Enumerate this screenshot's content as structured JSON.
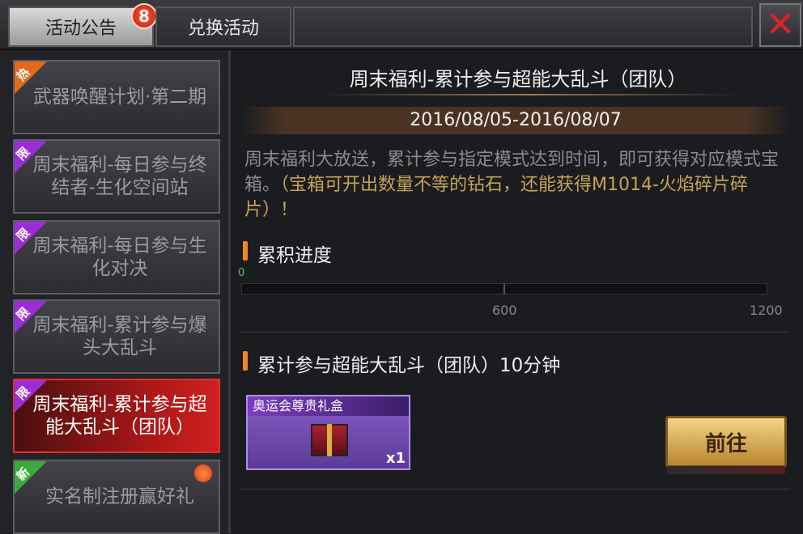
{
  "tabs": {
    "announcement_label": "活动公告",
    "announcement_badge": "8",
    "exchange_label": "兑换活动",
    "close_glyph": "✕"
  },
  "sidebar": {
    "items": [
      {
        "ribbon": "热",
        "ribbon_color": "#e06a18",
        "label": "武器唤醒计划·第二期"
      },
      {
        "ribbon": "限",
        "ribbon_color": "#9b2cd6",
        "label": "周末福利-每日参与终结者-生化空间站"
      },
      {
        "ribbon": "限",
        "ribbon_color": "#9b2cd6",
        "label": "周末福利-每日参与生化对决"
      },
      {
        "ribbon": "限",
        "ribbon_color": "#9b2cd6",
        "label": "周末福利-累计参与爆头大乱斗"
      },
      {
        "ribbon": "限",
        "ribbon_color": "#9b2cd6",
        "label": "周末福利-累计参与超能大乱斗（团队）",
        "selected": true
      },
      {
        "ribbon": "新",
        "ribbon_color": "#3da93a",
        "label": "实名制注册赢好礼",
        "has_dot": true
      }
    ]
  },
  "detail": {
    "title": "周末福利-累计参与超能大乱斗（团队）",
    "date_range": "2016/08/05-2016/08/07",
    "desc_normal": "周末福利大放送，累计参与指定模式达到时间，即可获得对应模式宝箱。",
    "desc_highlight": "（宝箱可开出数量不等的钻石，还能获得M1014-火焰碎片碎片）！",
    "progress_heading": "累积进度",
    "progress": {
      "current_label": "0",
      "value": 0,
      "max": 1200,
      "marks": [
        "600",
        "1200"
      ]
    },
    "task_heading": "累计参与超能大乱斗（团队）10分钟",
    "reward": {
      "name": "奥运会尊贵礼盒",
      "qty": "x1",
      "icon": "gift-box-icon"
    },
    "go_button": "前往"
  }
}
